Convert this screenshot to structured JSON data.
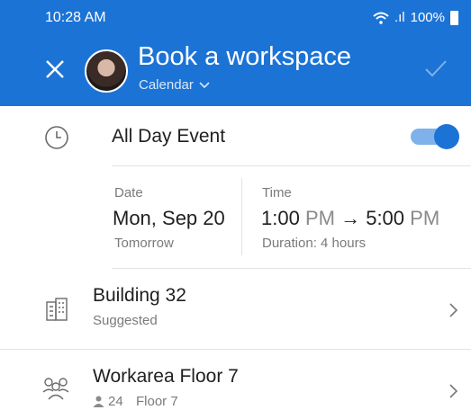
{
  "status": {
    "time": "10:28 AM",
    "battery": "100%",
    "signal": ".ıl"
  },
  "header": {
    "title": "Book a workspace",
    "calendar_label": "Calendar"
  },
  "icons": {
    "close": "close-icon",
    "confirm": "check-icon",
    "clock": "clock-icon",
    "building": "building-icon",
    "people": "people-icon",
    "chevron": "chevron-right-icon"
  },
  "all_day": {
    "label": "All Day Event",
    "enabled": true
  },
  "date": {
    "caption": "Date",
    "value": "Mon, Sep 20",
    "relative": "Tomorrow"
  },
  "time": {
    "caption": "Time",
    "start": "1:00",
    "start_ampm": "PM",
    "arrow": "→",
    "end": "5:00",
    "end_ampm": "PM",
    "duration": "Duration: 4 hours"
  },
  "building": {
    "name": "Building 32",
    "sub": "Suggested"
  },
  "workarea": {
    "name": "Workarea Floor 7",
    "capacity": "24",
    "floor": "Floor 7"
  },
  "colors": {
    "accent": "#1c73d6",
    "toggle_track": "#7fb1eb"
  }
}
